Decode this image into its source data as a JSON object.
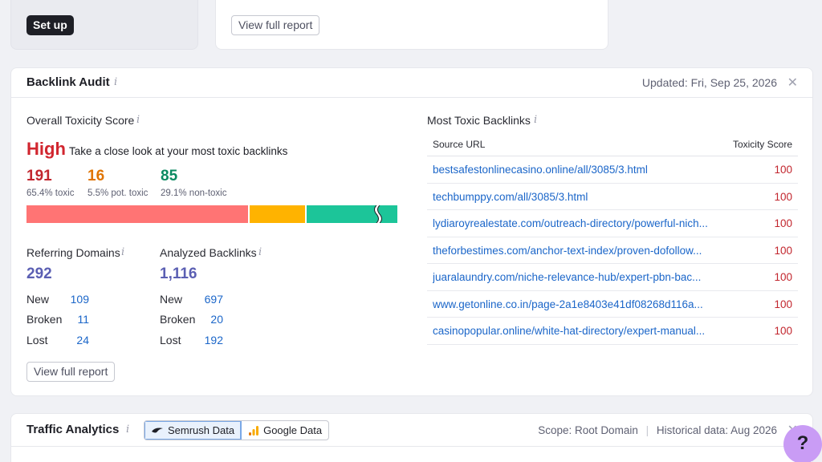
{
  "top": {
    "setup_label": "Set up",
    "view_report_label": "View full report"
  },
  "audit": {
    "title": "Backlink Audit",
    "updated": "Updated: Fri, Sep 25, 2026",
    "toxicity": {
      "label": "Overall Toxicity Score",
      "level": "High",
      "level_desc": "Take a close look at your most toxic backlinks",
      "toxic_count": "191",
      "toxic_label": "65.4% toxic",
      "pot_count": "16",
      "pot_label": "5.5% pot. toxic",
      "non_count": "85",
      "non_label": "29.1% non-toxic",
      "toxic_fraction": 0.654,
      "pot_fraction": 0.055,
      "non_fraction": 0.291,
      "colors": {
        "toxic": "#ff7474",
        "pot": "#ffb300",
        "non": "#1cc599"
      }
    },
    "referring": {
      "label": "Referring Domains",
      "total": "292",
      "rows": [
        {
          "label": "New",
          "value": "109"
        },
        {
          "label": "Broken",
          "value": "11"
        },
        {
          "label": "Lost",
          "value": "24"
        }
      ]
    },
    "analyzed": {
      "label": "Analyzed Backlinks",
      "total": "1,116",
      "rows": [
        {
          "label": "New",
          "value": "697"
        },
        {
          "label": "Broken",
          "value": "20"
        },
        {
          "label": "Lost",
          "value": "192"
        }
      ]
    },
    "view_report_label": "View full report",
    "toxic_table": {
      "label": "Most Toxic Backlinks",
      "col_source": "Source URL",
      "col_score": "Toxicity Score",
      "rows": [
        {
          "url": "bestsafestonlinecasino.online/all/3085/3.html",
          "score": "100"
        },
        {
          "url": "techbumppy.com/all/3085/3.html",
          "score": "100"
        },
        {
          "url": "lydiaroyrealestate.com/outreach-directory/powerful-nich...",
          "score": "100"
        },
        {
          "url": "theforbestimes.com/anchor-text-index/proven-dofollow...",
          "score": "100"
        },
        {
          "url": "juaralaundry.com/niche-relevance-hub/expert-pbn-bac...",
          "score": "100"
        },
        {
          "url": "www.getonline.co.in/page-2a1e8403e41df08268d116a...",
          "score": "100"
        },
        {
          "url": "casinopopular.online/white-hat-directory/expert-manual...",
          "score": "100"
        }
      ]
    }
  },
  "traffic": {
    "title": "Traffic Analytics",
    "semrush_label": "Semrush Data",
    "google_label": "Google Data",
    "scope": "Scope: Root Domain",
    "historical": "Historical data: Aug 2026"
  },
  "help": {
    "label": "?"
  }
}
